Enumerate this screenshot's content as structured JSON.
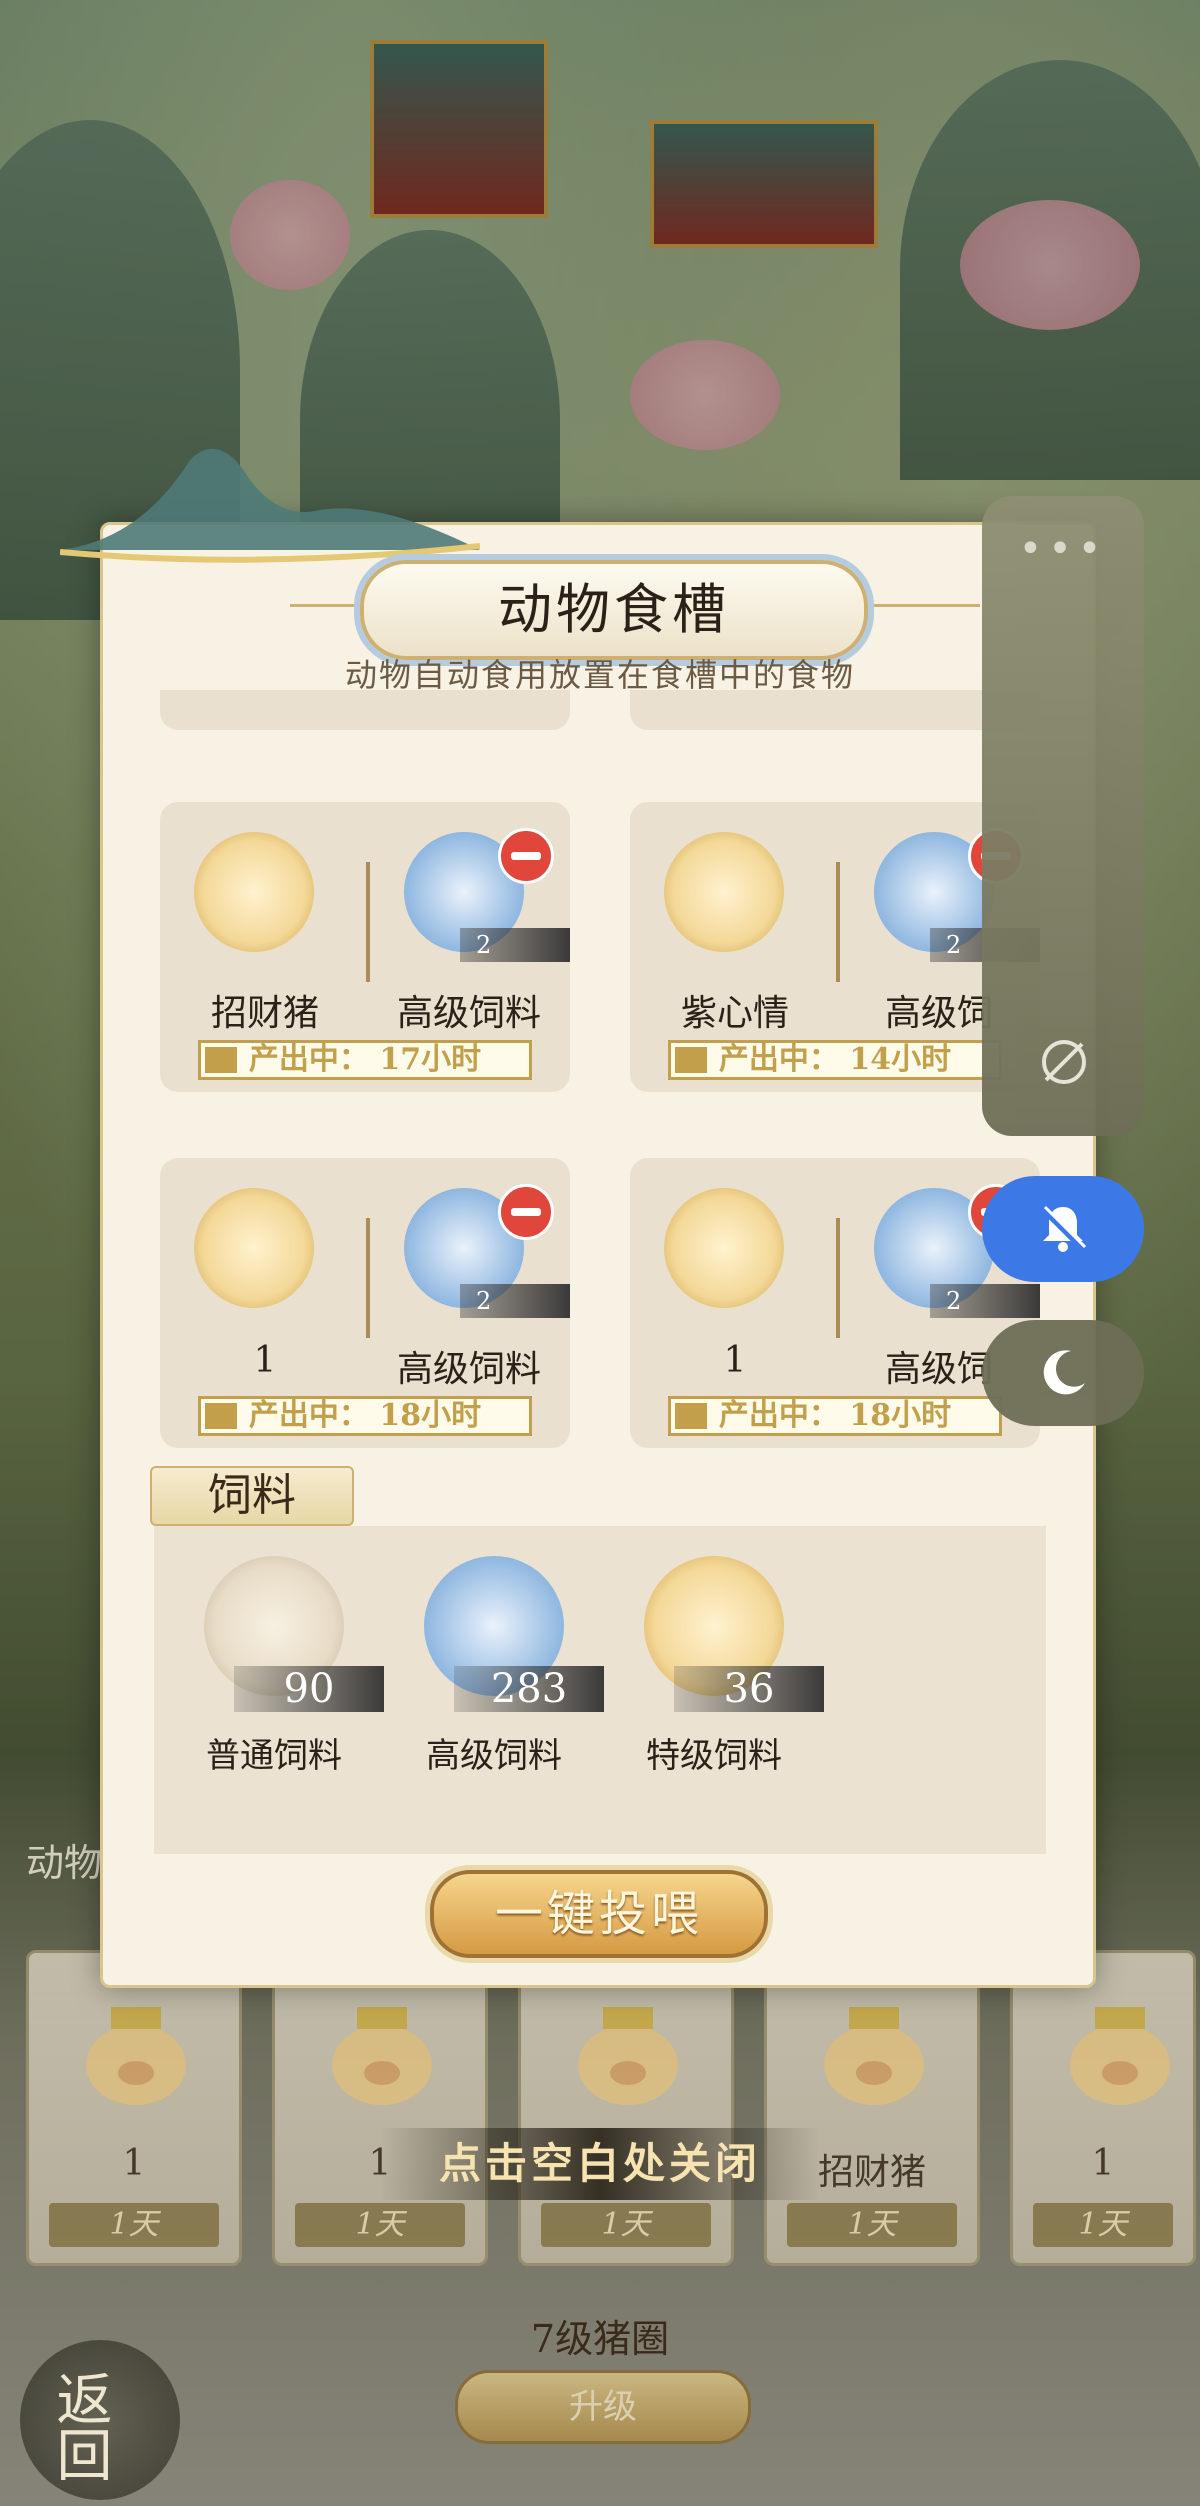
{
  "modal": {
    "title": "动物食槽",
    "subtitle": "动物自动食用放置在食槽中的食物"
  },
  "trough_cards": [
    {
      "animal": "招财猪",
      "feed": "高级饲料",
      "count": "2",
      "production": "产出中：  17小时"
    },
    {
      "animal": "紫心情",
      "feed": "高级饲",
      "count": "2",
      "production": "产出中：  14小时"
    },
    {
      "animal": "1",
      "feed": "高级饲料",
      "count": "2",
      "production": "产出中：  18小时"
    },
    {
      "animal": "1",
      "feed": "高级饲",
      "count": "2",
      "production": "产出中：  18小时"
    }
  ],
  "feed_section": {
    "header": "饲料",
    "items": [
      {
        "name": "普通饲料",
        "count": "90"
      },
      {
        "name": "高级饲料",
        "count": "283"
      },
      {
        "name": "特级饲料",
        "count": "36"
      }
    ],
    "feed_all_button": "一键投喂"
  },
  "background": {
    "close_hint": "点击空白处关闭",
    "side_label": "动物",
    "enclosure_slots": [
      {
        "name": "1",
        "days": "1天"
      },
      {
        "name": "1",
        "days": "1天"
      },
      {
        "name": "",
        "days": "1天"
      },
      {
        "name": "招财猪",
        "days": "1天"
      },
      {
        "name": "1",
        "days": "1天"
      }
    ],
    "level_text": "7级猪圈",
    "upgrade_button": "升级",
    "back_button": "返回"
  },
  "system_panel": {
    "dots": "•••"
  },
  "colors": {
    "accent_gold": "#c2a04b",
    "bell_blue": "#3d79e6",
    "remove_red": "#e0463a"
  }
}
